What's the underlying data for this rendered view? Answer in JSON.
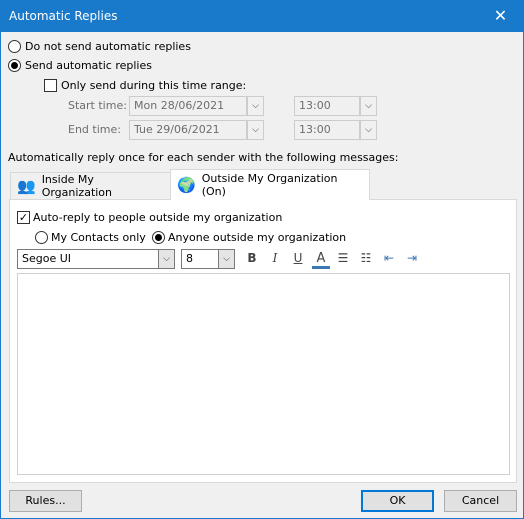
{
  "window": {
    "title": "Automatic Replies",
    "close": "✕"
  },
  "options": {
    "no_send": "Do not send automatic replies",
    "send": "Send automatic replies",
    "time_range": "Only send during this time range:"
  },
  "start": {
    "label": "Start time:",
    "date": "Mon 28/06/2021",
    "time": "13:00"
  },
  "end": {
    "label": "End time:",
    "date": "Tue 29/06/2021",
    "time": "13:00"
  },
  "instruction": "Automatically reply once for each sender with the following messages:",
  "tabs": [
    {
      "label": "Inside My Organization",
      "selected": false
    },
    {
      "label": "Outside My Organization (On)",
      "selected": true
    }
  ],
  "outside": {
    "auto_reply": "Auto-reply to people outside my organization",
    "contacts_only": "My Contacts only",
    "anyone": "Anyone outside my organization"
  },
  "toolbar": {
    "font": "Segoe UI",
    "size": "8",
    "bold": "B",
    "italic": "I",
    "underline": "U",
    "font_color": "A",
    "font_color_hex": "#3c78b4"
  },
  "message": "",
  "buttons": {
    "rules": "Rules...",
    "ok": "OK",
    "cancel": "Cancel"
  }
}
